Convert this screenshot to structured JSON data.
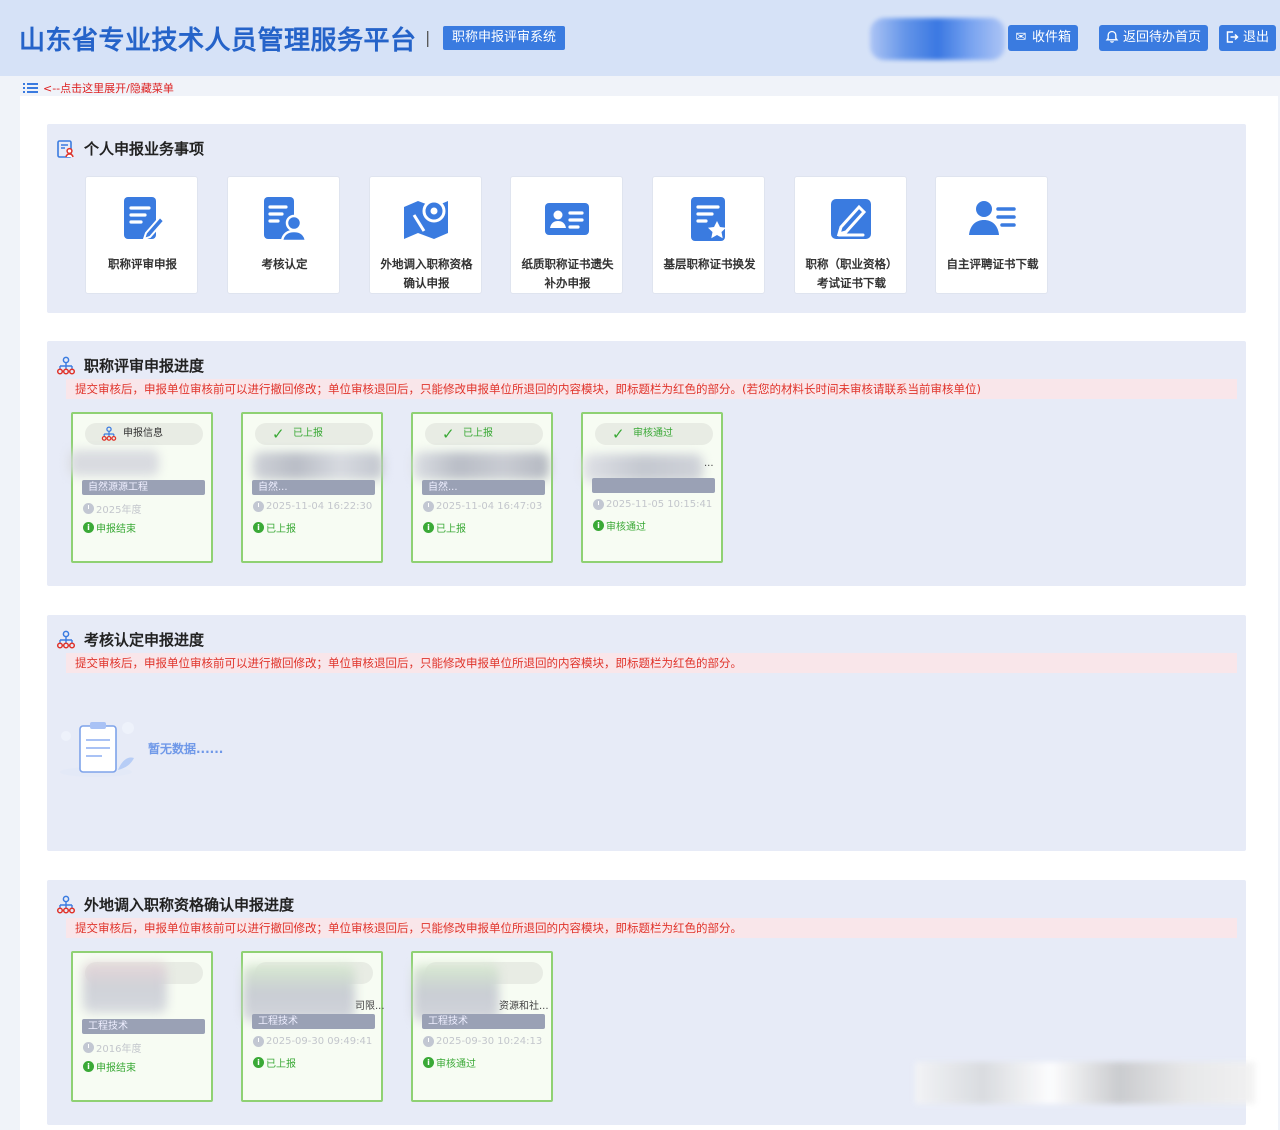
{
  "header": {
    "title": "山东省专业技术人员管理服务平台",
    "separator": "|",
    "system_badge": "职称申报评审系统",
    "buttons": {
      "inbox": "收件箱",
      "back_home": "返回待办首页",
      "logout": "退出"
    }
  },
  "menu_toggle": {
    "label": "<--点击这里展开/隐藏菜单"
  },
  "personal_services": {
    "title": "个人申报业务事项",
    "items": [
      {
        "label": "职称评审申报",
        "icon": "doc-edit-icon"
      },
      {
        "label": "考核认定",
        "icon": "doc-user-icon"
      },
      {
        "label": "外地调入职称资格确认申报",
        "icon": "map-pin-icon"
      },
      {
        "label": "纸质职称证书遗失补办申报",
        "icon": "id-card-icon"
      },
      {
        "label": "基层职称证书换发",
        "icon": "doc-star-icon"
      },
      {
        "label": "职称（职业资格）考试证书下载",
        "icon": "pen-board-icon"
      },
      {
        "label": "自主评聘证书下载",
        "icon": "user-list-icon"
      }
    ]
  },
  "title_progress": {
    "title": "职称评审申报进度",
    "tip": "提交审核后，申报单位审核前可以进行撤回修改；单位审核退回后，只能修改申报单位所退回的内容模块，即标题栏为红色的部分。(若您的材料长时间未审核请联系当前审核单位)",
    "cards": [
      {
        "pill": "申报信息",
        "pill_icon": "org-icon",
        "bar": "自然源源工程",
        "time": "2025年度",
        "status": "申报结束"
      },
      {
        "pill": "已上报",
        "pill_icon": "check-icon",
        "bar": "自然...",
        "time": "2025-11-04 16:22:30",
        "status": "已上报"
      },
      {
        "pill": "已上报",
        "pill_icon": "check-icon",
        "bar": "自然...",
        "time": "2025-11-04 16:47:03",
        "status": "已上报"
      },
      {
        "pill": "审核通过",
        "pill_icon": "check-icon",
        "bar": "",
        "extra": "...",
        "time": "2025-11-05 10:15:41",
        "status": "审核通过"
      }
    ]
  },
  "assessment_progress": {
    "title": "考核认定申报进度",
    "tip": "提交审核后，申报单位审核前可以进行撤回修改；单位审核退回后，只能修改申报单位所退回的内容模块，即标题栏为红色的部分。",
    "empty_text": "暂无数据......"
  },
  "transfer_progress": {
    "title": "外地调入职称资格确认申报进度",
    "tip": "提交审核后，申报单位审核前可以进行撤回修改；单位审核退回后，只能修改申报单位所退回的内容模块，即标题栏为红色的部分。",
    "cards": [
      {
        "pill": "",
        "bar": "工程技术",
        "time": "2016年度",
        "status": "申报结束"
      },
      {
        "pill": "",
        "extra": "司限...",
        "bar": "工程技术",
        "time": "2025-09-30 09:49:41",
        "status": "已上报"
      },
      {
        "pill": "",
        "extra": "资源和社...",
        "bar": "工程技术",
        "time": "2025-09-30 10:24:13",
        "status": "审核通过"
      }
    ]
  },
  "colors": {
    "primary": "#3a7be0",
    "header_bg": "#d6e2f7",
    "panel_bg": "#e7ebf7",
    "tip_text": "#e0342b",
    "card_border": "#8fd173",
    "success": "#3aa936"
  }
}
